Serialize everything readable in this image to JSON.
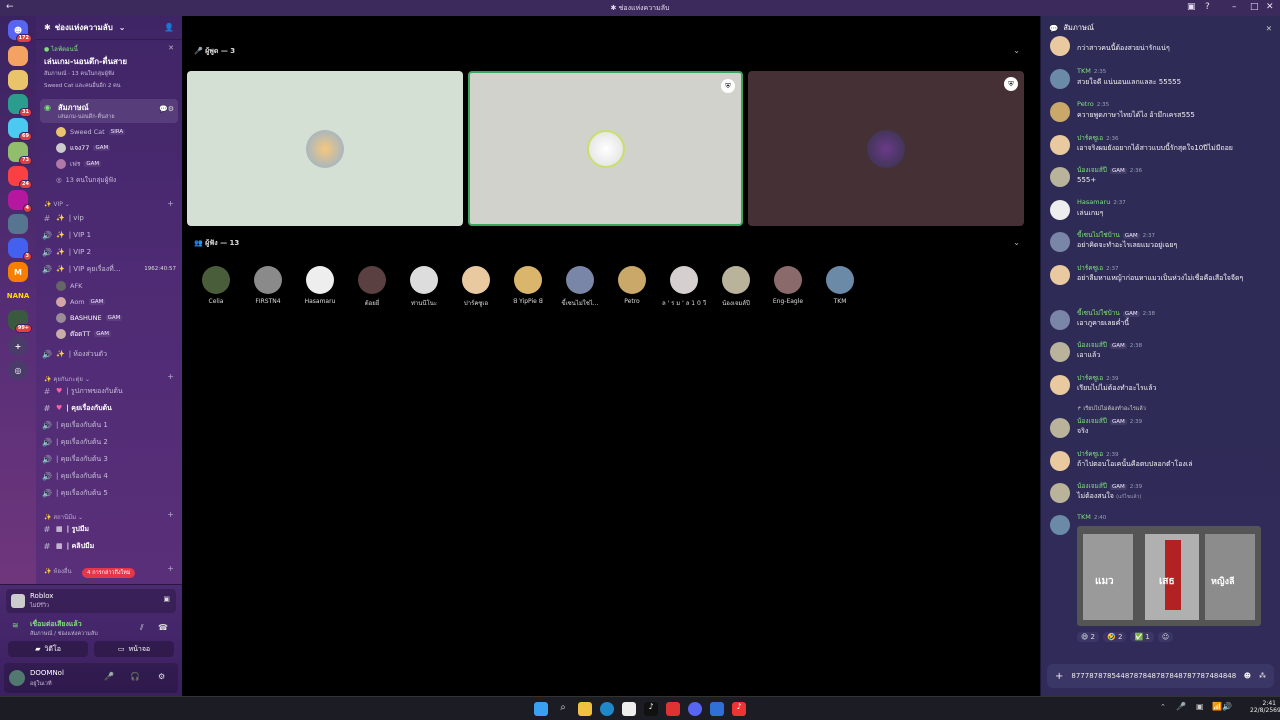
{
  "window": {
    "title": "ช่องแห่งความลับ"
  },
  "rail": {
    "badges": [
      "172",
      "31",
      "69",
      "73",
      "24",
      "4",
      "3",
      "99+"
    ],
    "nana": "NANA"
  },
  "channels": {
    "server_name": "ช่องแห่งความลับ",
    "event": {
      "label": "ไลฟ์ตอนนี้",
      "title": "เล่นเกม-นอนดึก-ตื่นสาย",
      "sub": "สัมภาษณ์ · 13 คนในกลุ่มผู้ฟัง",
      "sub2": "Sweed Cat และคนอื่นอีก 2 คน"
    },
    "active_channel": {
      "name": "สัมภาษณ์",
      "topic": "เล่นเกม-นอนดึก-ตื่นสาย"
    },
    "voice_users": [
      {
        "name": "Sweed Cat",
        "tag": "SIRA"
      },
      {
        "name": "แจง77",
        "tag": "GAM"
      },
      {
        "name": "เฟร",
        "tag": "GAM"
      },
      {
        "name": "13 คนในกลุ่มผู้ฟัง",
        "tag": ""
      }
    ],
    "cat_vip": "VIP",
    "vip_items": [
      "| vip",
      "| VIP 1",
      "| VIP 2",
      "| VIP คุยเรื่องที่..."
    ],
    "vip_timer": "1962:40:57",
    "afk_users": [
      {
        "name": "AFK",
        "tag": ""
      },
      {
        "name": "Aom",
        "tag": "GAM"
      },
      {
        "name": "BASHUNE",
        "tag": "GAM"
      },
      {
        "name": "ต๊อดTT",
        "tag": "GAM"
      }
    ],
    "room_alone": "| ห้องส่วนตัว",
    "cat_talk": "คุยกันกะตุ่ย",
    "talk_items": [
      "| รูปภาพของกับต้น",
      "| คุยเรื่องกับต้น",
      "| คุยเรื่องกับต้น 1",
      "| คุยเรื่องกับต้น 2",
      "| คุยเรื่องกับต้น 3",
      "| คุยเรื่องกับต้น 4",
      "| คุยเรื่องกับต้น 5"
    ],
    "cat_mim": "สถานีมีม",
    "mim_items": [
      "| รูปมีม",
      "| คลิปมีม"
    ],
    "cat_other": "ห้องอื่น",
    "new_mentions": "4 การกล่าวถึงใหม่"
  },
  "activity": {
    "game": "Roblox",
    "status": "ไม่มีรีวิว"
  },
  "voice": {
    "connected": "เชื่อมต่อเสียงแล้ว",
    "path": "สัมภาษณ์ / ช่องแห่งความลับ",
    "video": "วิดีโอ",
    "screen": "หน้าจอ"
  },
  "user": {
    "name": "DOOMNol",
    "status": "อยู่ในเวที"
  },
  "stage": {
    "speakers_label": "ผู้พูด — 3",
    "listeners_label": "ผู้ฟัง — 13",
    "listeners": [
      "Celia",
      "FIRSTN4",
      "Hasamaru",
      "ต้อยยี่",
      "ท่านนีโนะ",
      "ปาร์คซูเอ",
      "ꓭ YipPie ꓭ",
      "ขี้เซนไม่ใช่ไ...",
      "Petro",
      "ล ' ร ม ' ล 1 0 วี",
      "น้องเจมส์ปี",
      "Eng-Eagle",
      "TKM"
    ]
  },
  "chat": {
    "title": "สัมภาษณ์",
    "messages": [
      {
        "name": "",
        "time": "",
        "text": "กว่าสาวคนนี้ต้องสวยน่ารักแน่ๆ"
      },
      {
        "name": "TKM",
        "time": "2:35",
        "text": "สวยใจดี แน่นอนแลกแลละ 55555"
      },
      {
        "name": "Petro",
        "time": "2:35",
        "text": "ควายพูดภาษาไทยได้ไง อ้ามึกเครส555"
      },
      {
        "name": "ปาร์คซูเอ",
        "time": "2:36",
        "text": "เอาจริงผมยังอยากได้สาวแบบนี้รักสุดใจ10ปีไม่มีถอย"
      },
      {
        "name": "น้องเจมส์ปี",
        "time": "2:36",
        "text": "555+"
      },
      {
        "name": "Hasamaru",
        "time": "2:37",
        "text": "เล่นเกมๆ"
      },
      {
        "name": "ขี้เซนไม่ใช่บ้าน",
        "time": "2:37",
        "text": "อย่าคิดจะทำอะไรเลยแมวอยู่เฉยๆ"
      },
      {
        "name": "ปาร์คซูเอ",
        "time": "2:37",
        "text": "อย่าลืมหาแหญ้าก่อนหาแมวเป็นห่วงไม่เชื่อคือเสือใจจืดๆ"
      },
      {
        "name": "ขี้เซนไม่ใช่บ้าน",
        "time": "2:38",
        "text": "เอาภูคายเลยค่ำนี้"
      },
      {
        "name": "น้องเจมส์ปี",
        "time": "2:38",
        "text": "เอาแล้ว"
      },
      {
        "name": "ปาร์คซูเอ",
        "time": "2:39",
        "text": "เรียบไปไม่ต้องทำอะไรแล้ว"
      },
      {
        "name": "น้องเจมส์ปี",
        "time": "2:39",
        "text": "จริง"
      },
      {
        "name": "ปาร์คซูเอ",
        "time": "2:39",
        "text": "ถ้าไปตอบโอเคนั้นคือตบปลอกตำโองเล่"
      },
      {
        "name": "น้องเจมส์ปี",
        "time": "2:39",
        "text": "ไม่ต้องสนใจ"
      },
      {
        "name": "TKM",
        "time": "2:40",
        "text": ""
      }
    ],
    "reply_preview": "เรียบไปไม่ต้องทำอะไรแล้ว",
    "edited": "(แก้ไขแล้ว)",
    "gif_words": [
      "แมว",
      "เสธ",
      "หญิงลี"
    ],
    "reactions": [
      {
        "e": "😄",
        "c": "2"
      },
      {
        "e": "🤣",
        "c": "2"
      },
      {
        "e": "✅",
        "c": "1"
      }
    ],
    "composer_value": "8777878785448787848787848787787484848"
  },
  "taskbar": {
    "time": "2:41",
    "date": "22/8/2569"
  },
  "colors": {
    "accent": "#7ee07a",
    "brand": "#5a2f78"
  }
}
